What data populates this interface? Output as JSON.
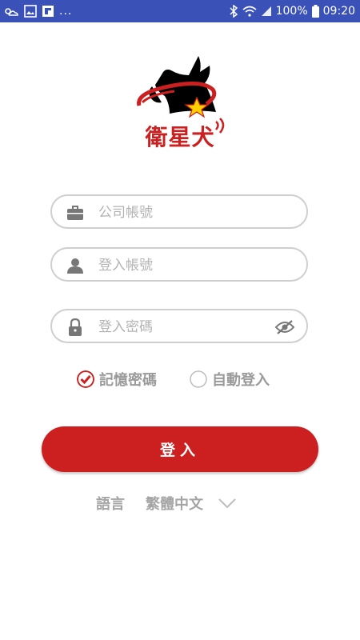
{
  "status_bar": {
    "battery": "100%",
    "time": "09:20",
    "overflow": "..."
  },
  "brand": {
    "name": "衛星犬",
    "primary_color": "#cc1f1f"
  },
  "form": {
    "company_account": {
      "placeholder": "公司帳號",
      "value": "",
      "icon": "briefcase-icon"
    },
    "login_account": {
      "placeholder": "登入帳號",
      "value": "",
      "icon": "user-icon"
    },
    "login_password": {
      "placeholder": "登入密碼",
      "value": "",
      "icon": "lock-icon",
      "visibility_icon": "eye-off-icon"
    }
  },
  "options": {
    "remember_password": {
      "label": "記憶密碼",
      "checked": true
    },
    "auto_login": {
      "label": "自動登入",
      "checked": false
    }
  },
  "login_button": {
    "label": "登入"
  },
  "language": {
    "label": "語言",
    "selected": "繁體中文"
  }
}
